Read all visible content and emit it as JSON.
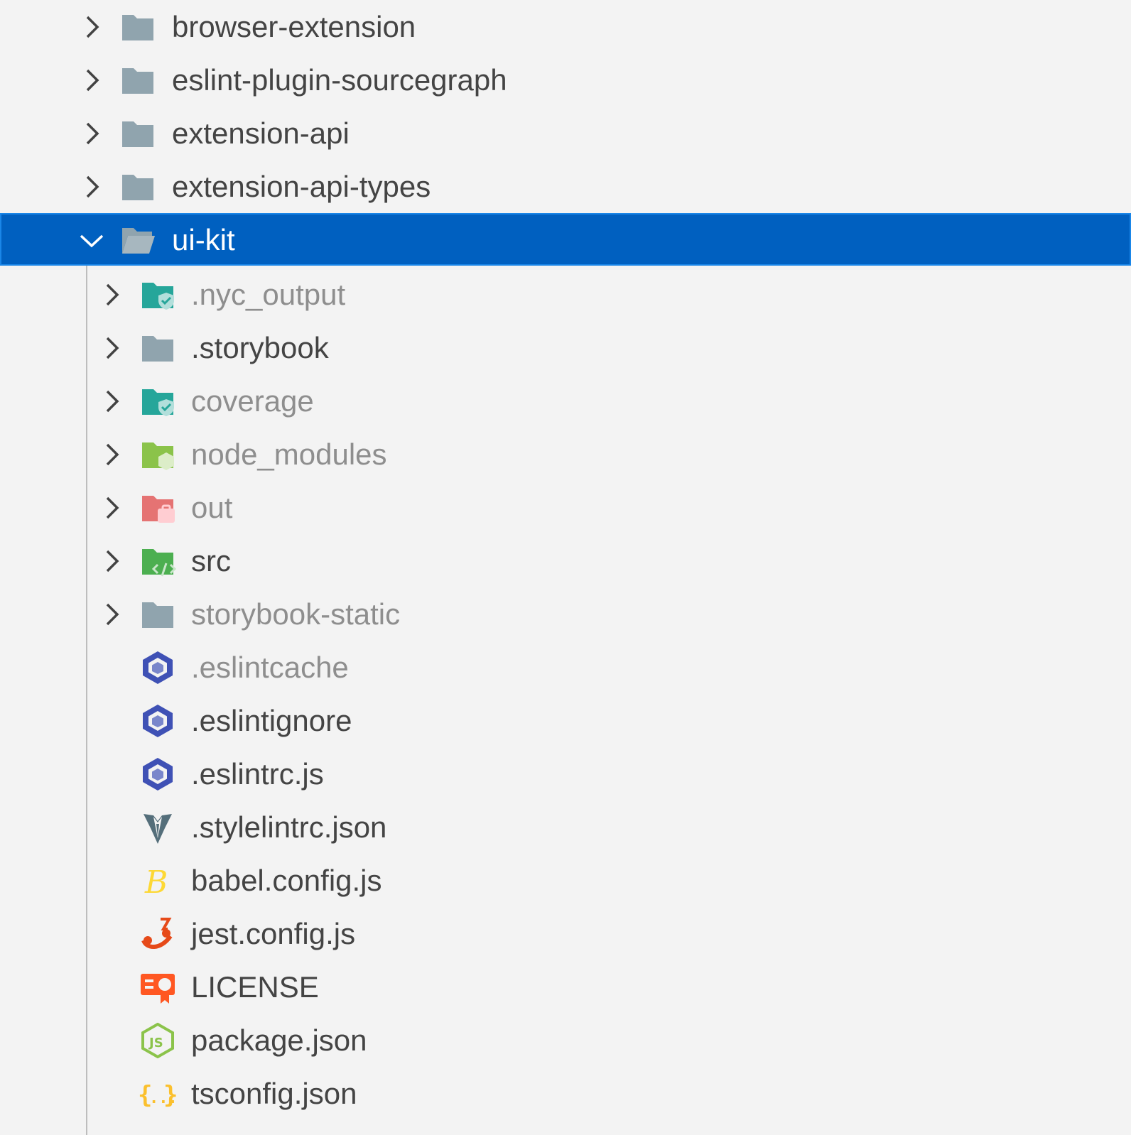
{
  "explorer": {
    "items": [
      {
        "label": "browser-extension",
        "kind": "folder",
        "icon": "folder-icon",
        "expanded": false,
        "depth": 0,
        "dim": false
      },
      {
        "label": "eslint-plugin-sourcegraph",
        "kind": "folder",
        "icon": "folder-icon",
        "expanded": false,
        "depth": 0,
        "dim": false
      },
      {
        "label": "extension-api",
        "kind": "folder",
        "icon": "folder-icon",
        "expanded": false,
        "depth": 0,
        "dim": false
      },
      {
        "label": "extension-api-types",
        "kind": "folder",
        "icon": "folder-icon",
        "expanded": false,
        "depth": 0,
        "dim": false
      },
      {
        "label": "ui-kit",
        "kind": "folder",
        "icon": "folder-open-icon",
        "expanded": true,
        "depth": 0,
        "dim": false,
        "selected": true
      },
      {
        "label": ".nyc_output",
        "kind": "folder",
        "icon": "folder-coverage-icon",
        "expanded": false,
        "depth": 1,
        "dim": true
      },
      {
        "label": ".storybook",
        "kind": "folder",
        "icon": "folder-icon",
        "expanded": false,
        "depth": 1,
        "dim": false
      },
      {
        "label": "coverage",
        "kind": "folder",
        "icon": "folder-coverage-icon",
        "expanded": false,
        "depth": 1,
        "dim": true
      },
      {
        "label": "node_modules",
        "kind": "folder",
        "icon": "folder-node-icon",
        "expanded": false,
        "depth": 1,
        "dim": true
      },
      {
        "label": "out",
        "kind": "folder",
        "icon": "folder-dist-icon",
        "expanded": false,
        "depth": 1,
        "dim": true
      },
      {
        "label": "src",
        "kind": "folder",
        "icon": "folder-src-icon",
        "expanded": false,
        "depth": 1,
        "dim": false
      },
      {
        "label": "storybook-static",
        "kind": "folder",
        "icon": "folder-icon",
        "expanded": false,
        "depth": 1,
        "dim": true
      },
      {
        "label": ".eslintcache",
        "kind": "file",
        "icon": "eslint-icon",
        "depth": 1,
        "dim": true
      },
      {
        "label": ".eslintignore",
        "kind": "file",
        "icon": "eslint-icon",
        "depth": 1,
        "dim": false
      },
      {
        "label": ".eslintrc.js",
        "kind": "file",
        "icon": "eslint-icon",
        "depth": 1,
        "dim": false
      },
      {
        "label": ".stylelintrc.json",
        "kind": "file",
        "icon": "stylelint-icon",
        "depth": 1,
        "dim": false
      },
      {
        "label": "babel.config.js",
        "kind": "file",
        "icon": "babel-icon",
        "depth": 1,
        "dim": false
      },
      {
        "label": "jest.config.js",
        "kind": "file",
        "icon": "jest-icon",
        "depth": 1,
        "dim": false
      },
      {
        "label": "LICENSE",
        "kind": "file",
        "icon": "license-icon",
        "depth": 1,
        "dim": false
      },
      {
        "label": "package.json",
        "kind": "file",
        "icon": "nodejs-icon",
        "depth": 1,
        "dim": false
      },
      {
        "label": "tsconfig.json",
        "kind": "file",
        "icon": "json-braces-icon",
        "depth": 1,
        "dim": false
      }
    ]
  },
  "colors": {
    "background": "#f3f3f3",
    "selection": "#0060c0",
    "folder": "#90a4ae",
    "text": "#444444",
    "text_dim": "#8e8e8e"
  }
}
